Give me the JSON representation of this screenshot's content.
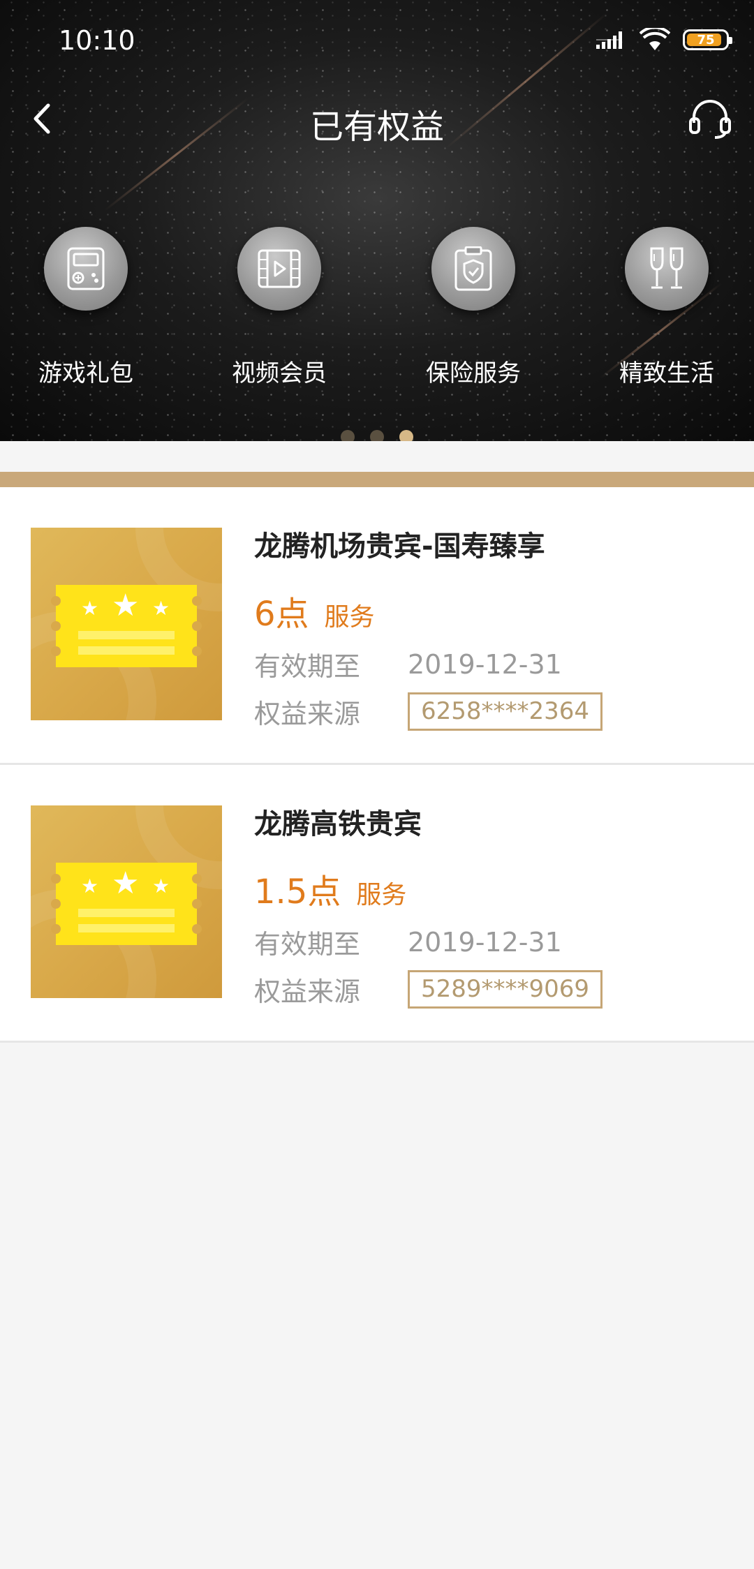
{
  "status_bar": {
    "time": "10:10",
    "battery_level": "75"
  },
  "header": {
    "title": "已有权益"
  },
  "categories": [
    {
      "label": "游戏礼包",
      "icon": "game-console-icon"
    },
    {
      "label": "视频会员",
      "icon": "video-film-icon"
    },
    {
      "label": "保险服务",
      "icon": "insurance-shield-icon"
    },
    {
      "label": "精致生活",
      "icon": "champagne-glasses-icon"
    }
  ],
  "carousel": {
    "page_count": 3,
    "active_index": 2
  },
  "benefits": [
    {
      "title": "龙腾机场贵宾-国寿臻享",
      "points": "6点",
      "type": "服务",
      "expiry_label": "有效期至",
      "expiry_value": "2019-12-31",
      "source_label": "权益来源",
      "source_value": "6258****2364"
    },
    {
      "title": "龙腾高铁贵宾",
      "points": "1.5点",
      "type": "服务",
      "expiry_label": "有效期至",
      "expiry_value": "2019-12-31",
      "source_label": "权益来源",
      "source_value": "5289****9069"
    }
  ],
  "colors": {
    "accent_orange": "#e07b1c",
    "gold": "#c9a87a",
    "ticket_yellow": "#ffe31a"
  }
}
